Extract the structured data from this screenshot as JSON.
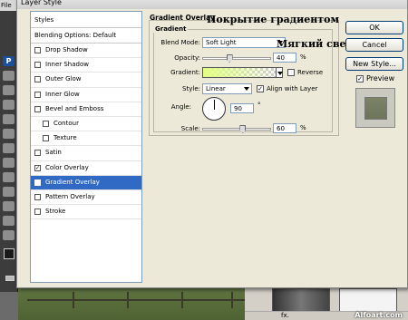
{
  "background_app": {
    "menu_label": "File",
    "tool_letter": "P",
    "watermark": "Alfoart.com",
    "layers_bar_label": "fx."
  },
  "dialog": {
    "title": "Layer Style"
  },
  "style_list": {
    "header": "Styles",
    "blending_options": "Blending Options: Default",
    "items": [
      {
        "label": "Drop Shadow",
        "checked": false,
        "indent": false,
        "selected": false
      },
      {
        "label": "Inner Shadow",
        "checked": false,
        "indent": false,
        "selected": false
      },
      {
        "label": "Outer Glow",
        "checked": false,
        "indent": false,
        "selected": false
      },
      {
        "label": "Inner Glow",
        "checked": false,
        "indent": false,
        "selected": false
      },
      {
        "label": "Bevel and Emboss",
        "checked": false,
        "indent": false,
        "selected": false
      },
      {
        "label": "Contour",
        "checked": false,
        "indent": true,
        "selected": false
      },
      {
        "label": "Texture",
        "checked": false,
        "indent": true,
        "selected": false
      },
      {
        "label": "Satin",
        "checked": false,
        "indent": false,
        "selected": false
      },
      {
        "label": "Color Overlay",
        "checked": true,
        "indent": false,
        "selected": false
      },
      {
        "label": "Gradient Overlay",
        "checked": true,
        "indent": false,
        "selected": true
      },
      {
        "label": "Pattern Overlay",
        "checked": false,
        "indent": false,
        "selected": false
      },
      {
        "label": "Stroke",
        "checked": false,
        "indent": false,
        "selected": false
      }
    ]
  },
  "gradient_overlay": {
    "group_title": "Gradient Overlay",
    "sub_title": "Gradient",
    "blend_mode_label": "Blend Mode:",
    "blend_mode_value": "Soft Light",
    "opacity_label": "Opacity:",
    "opacity_value": "40",
    "opacity_unit": "%",
    "opacity_fraction": 0.4,
    "gradient_label": "Gradient:",
    "gradient_color": "#e1ff82",
    "reverse_label": "Reverse",
    "reverse_checked": false,
    "style_label": "Style:",
    "style_value": "Linear",
    "align_label": "Align with Layer",
    "align_checked": true,
    "angle_label": "Angle:",
    "angle_value": "90",
    "angle_unit": "°",
    "scale_label": "Scale:",
    "scale_value": "60",
    "scale_unit": "%",
    "scale_fraction": 0.6
  },
  "annotations": {
    "gradient_overlay_ru": "Покрытие градиентом",
    "soft_light_ru": "Мягкий свет"
  },
  "buttons": {
    "ok": "OK",
    "cancel": "Cancel",
    "new_style": "New Style...",
    "preview_label": "Preview",
    "preview_checked": true
  },
  "colors": {
    "selected": "#316ac5",
    "dialog_bg": "#ece9d8"
  }
}
